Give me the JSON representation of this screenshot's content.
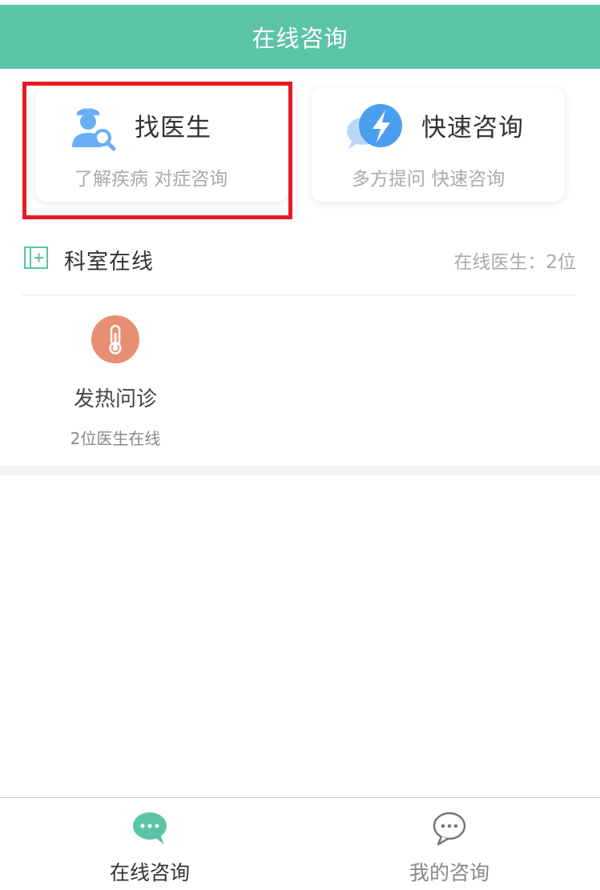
{
  "header": {
    "title": "在线咨询"
  },
  "cards": {
    "find_doctor": {
      "title": "找医生",
      "subtitle": "了解疾病 对症咨询",
      "icon": "doctor-search-icon"
    },
    "quick_consult": {
      "title": "快速咨询",
      "subtitle": "多方提问 快速咨询",
      "icon": "lightning-chat-icon"
    }
  },
  "department": {
    "title": "科室在线",
    "online_count": "在线医生：2位",
    "items": [
      {
        "name": "发热问诊",
        "sub": "2位医生在线",
        "icon": "thermometer-icon",
        "color": "#e88e74"
      }
    ]
  },
  "tabbar": {
    "online_label": "在线咨询",
    "mine_label": "我的咨询",
    "active_color": "#5cc4a6"
  },
  "colors": {
    "brand": "#5cc4a6",
    "highlight": "#e51b24",
    "quick_icon": "#4a9ff0"
  }
}
